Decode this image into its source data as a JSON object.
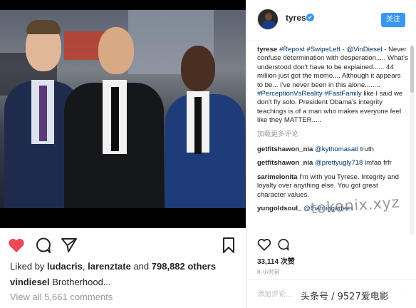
{
  "post": {
    "liked_by": {
      "prefix": "Liked by ",
      "user1": "ludacris",
      "sep": ", ",
      "user2": "larenztate",
      "and": " and ",
      "count": "798,882 others"
    },
    "caption": {
      "user": "vindiesel",
      "text": " Brotherhood..."
    },
    "view_all": "View all 5,661 comments"
  },
  "panel": {
    "header": {
      "username": "tyrese",
      "follow_label": "关注",
      "verified_mark": "✔"
    },
    "comments": [
      {
        "user": "tyrese",
        "parts": [
          {
            "t": " "
          },
          {
            "t": "#Repost",
            "tag": true
          },
          {
            "t": " "
          },
          {
            "t": "#SwipeLeft",
            "tag": true
          },
          {
            "t": " - "
          },
          {
            "t": "@VinDiesel",
            "tag": true
          },
          {
            "t": " - Never confuse determination with desperation..... What's understood don't have to be explained...... 44 million just got the memo.... Although it appears to be... I've never been in this alone........ "
          },
          {
            "t": "#PerceptionVsReality",
            "tag": true
          },
          {
            "t": " "
          },
          {
            "t": "#FastFamily",
            "tag": true
          },
          {
            "t": " like I said we don't fly solo. President Obama's integrity teachings is of a man who makes everyone feel like they MATTER....."
          }
        ]
      }
    ],
    "load_more": "加载更多评论",
    "replies": [
      {
        "user": "getfitshawon_nia",
        "parts": [
          {
            "t": " "
          },
          {
            "t": "@kythomasatl",
            "tag": true
          },
          {
            "t": " truth"
          }
        ]
      },
      {
        "user": "getfitshawon_nia",
        "parts": [
          {
            "t": " "
          },
          {
            "t": "@prettyugly718",
            "tag": true
          },
          {
            "t": " lmfao frfr"
          }
        ]
      },
      {
        "user": "sarimelonita",
        "parts": [
          {
            "t": " I'm with you Tyrese. Integrity and loyalty over anything else. You got great character values."
          }
        ]
      },
      {
        "user": "yungoldsoul_",
        "parts": [
          {
            "t": " "
          },
          {
            "t": "@thatniggadees",
            "tag": true
          }
        ]
      }
    ],
    "likes": "33,114 次赞",
    "time": "8 小时前",
    "add_comment": "添加评论...",
    "more": "···"
  },
  "overlays": {
    "watermark": "tokenix.xyz",
    "source": "头条号 / 9527爱电影"
  },
  "colors": {
    "accent": "#3897f0",
    "heart": "#ed4956",
    "link": "#003569",
    "muted": "#999999"
  },
  "icons": {
    "like": "heart-filled-icon",
    "comment": "comment-bubble-icon",
    "share": "paper-plane-icon",
    "save": "bookmark-icon",
    "panel_like": "heart-outline-icon",
    "panel_comment": "comment-bubble-icon"
  }
}
